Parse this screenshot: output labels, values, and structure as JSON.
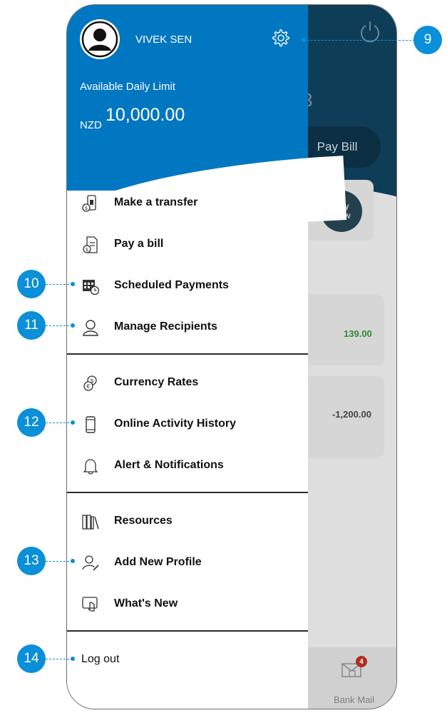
{
  "user": {
    "name": "VIVEK SEN"
  },
  "limit": {
    "label": "Available Daily Limit",
    "currency": "NZD",
    "amount": "10,000.00"
  },
  "menu_group1": [
    {
      "label": "Make a transfer",
      "icon": "transfer-icon"
    },
    {
      "label": "Pay a bill",
      "icon": "bill-icon"
    },
    {
      "label": "Scheduled Payments",
      "icon": "calendar-clock-icon"
    },
    {
      "label": "Manage Recipients",
      "icon": "recipient-icon"
    }
  ],
  "menu_group2": [
    {
      "label": "Currency Rates",
      "icon": "currency-icon"
    },
    {
      "label": "Online Activity History",
      "icon": "phone-icon"
    },
    {
      "label": "Alert & Notifications",
      "icon": "bell-icon"
    }
  ],
  "menu_group3": [
    {
      "label": "Resources",
      "icon": "books-icon"
    },
    {
      "label": "Add New Profile",
      "icon": "add-profile-icon"
    },
    {
      "label": "What's New",
      "icon": "touch-screen-icon"
    }
  ],
  "logout": {
    "label": "Log out"
  },
  "background": {
    "pay_bill": "Pay Bill",
    "pay_now_line1": "Pay",
    "pay_now_line2": "Now",
    "amount1": "139.00",
    "amount2": "-1,200.00",
    "bank_mail_label": "Bank Mail",
    "bank_mail_badge": "4",
    "partial_digit": "3"
  },
  "callouts": {
    "c9": "9",
    "c10": "10",
    "c11": "11",
    "c12": "12",
    "c13": "13",
    "c14": "14"
  },
  "colors": {
    "brand_blue": "#0077c0",
    "callout": "#0a8fd8",
    "positive": "#2e8b3a"
  }
}
